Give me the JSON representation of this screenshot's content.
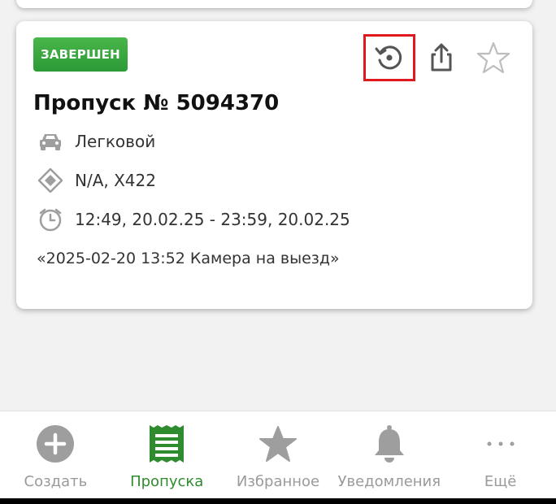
{
  "pass": {
    "status": "ЗАВЕРШЕН",
    "title": "Пропуск № 5094370",
    "vehicle_type": "Легковой",
    "plate": "N/A, X422",
    "period": "12:49, 20.02.25 - 23:59, 20.02.25",
    "comment": "«2025-02-20 13:52 Камера на выезд»"
  },
  "actions": {
    "icons": [
      "history-icon",
      "share-icon",
      "star-outline-icon"
    ]
  },
  "tabbar": {
    "items": [
      {
        "label": "Создать",
        "icon": "plus-circle-icon"
      },
      {
        "label": "Пропуска",
        "icon": "pass-list-icon",
        "active": true
      },
      {
        "label": "Избранное",
        "icon": "star-icon"
      },
      {
        "label": "Уведомления",
        "icon": "bell-icon"
      },
      {
        "label": "Ещё",
        "icon": "more-icon"
      }
    ]
  },
  "colors": {
    "status_green": "#3aa93f",
    "active_tab": "#2e8b2e",
    "highlight_red": "#e0191e"
  }
}
